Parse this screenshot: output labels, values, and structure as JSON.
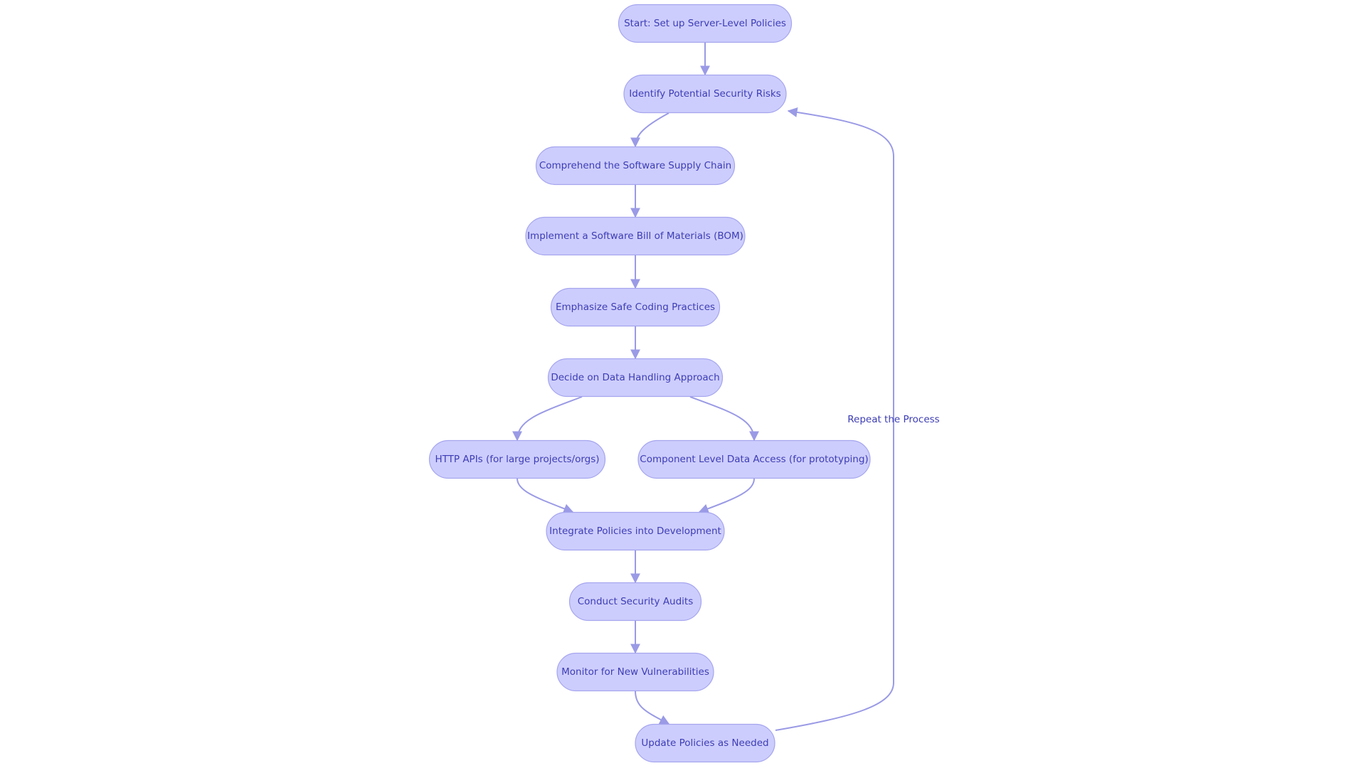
{
  "diagram": {
    "type": "flowchart",
    "colors": {
      "node_fill": "#cdcdfd",
      "node_border": "#a5a5ef",
      "text": "#3d3db5",
      "edge": "#9a9ae6"
    },
    "nodes": [
      {
        "id": "start",
        "label": "Start: Set up Server-Level Policies"
      },
      {
        "id": "identify",
        "label": "Identify Potential Security Risks"
      },
      {
        "id": "comprehend",
        "label": "Comprehend the Software Supply Chain"
      },
      {
        "id": "bom",
        "label": "Implement a Software Bill of Materials (BOM)"
      },
      {
        "id": "safe",
        "label": "Emphasize Safe Coding Practices"
      },
      {
        "id": "decide",
        "label": "Decide on Data Handling Approach"
      },
      {
        "id": "http",
        "label": "HTTP APIs (for large projects/orgs)"
      },
      {
        "id": "component",
        "label": "Component Level Data Access (for prototyping)"
      },
      {
        "id": "integrate",
        "label": "Integrate Policies into Development"
      },
      {
        "id": "audits",
        "label": "Conduct Security Audits"
      },
      {
        "id": "monitor",
        "label": "Monitor for New Vulnerabilities"
      },
      {
        "id": "update",
        "label": "Update Policies as Needed"
      }
    ],
    "edges": [
      {
        "from": "start",
        "to": "identify"
      },
      {
        "from": "identify",
        "to": "comprehend"
      },
      {
        "from": "comprehend",
        "to": "bom"
      },
      {
        "from": "bom",
        "to": "safe"
      },
      {
        "from": "safe",
        "to": "decide"
      },
      {
        "from": "decide",
        "to": "http"
      },
      {
        "from": "decide",
        "to": "component"
      },
      {
        "from": "http",
        "to": "integrate"
      },
      {
        "from": "component",
        "to": "integrate"
      },
      {
        "from": "integrate",
        "to": "audits"
      },
      {
        "from": "audits",
        "to": "monitor"
      },
      {
        "from": "monitor",
        "to": "update"
      },
      {
        "from": "update",
        "to": "identify",
        "label": "Repeat the Process"
      }
    ]
  }
}
